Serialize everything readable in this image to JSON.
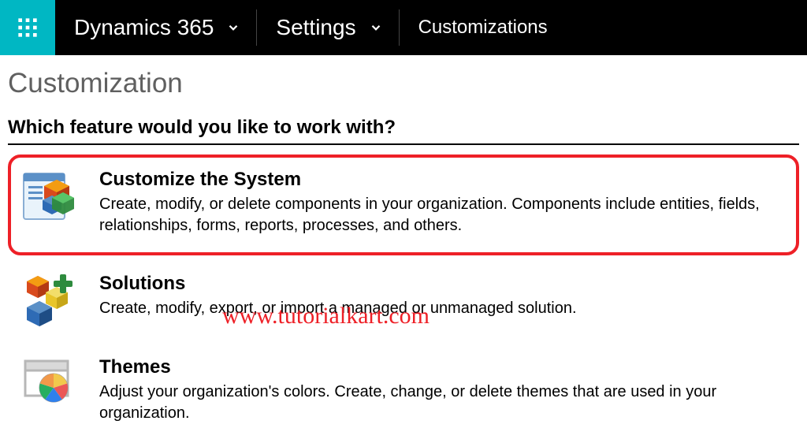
{
  "nav": {
    "app_label": "Dynamics 365",
    "section_label": "Settings",
    "breadcrumb": "Customizations"
  },
  "page_title": "Customization",
  "subheading": "Which feature would you like to work with?",
  "features": [
    {
      "title": "Customize the System",
      "desc": "Create, modify, or delete components in your organization. Components include entities, fields, relationships, forms, reports, processes, and others."
    },
    {
      "title": "Solutions",
      "desc": "Create, modify, export, or import a managed or unmanaged solution."
    },
    {
      "title": "Themes",
      "desc": "Adjust your organization's colors. Create, change, or delete themes that are used in your organization."
    }
  ],
  "watermark": "www.tutorialkart.com"
}
